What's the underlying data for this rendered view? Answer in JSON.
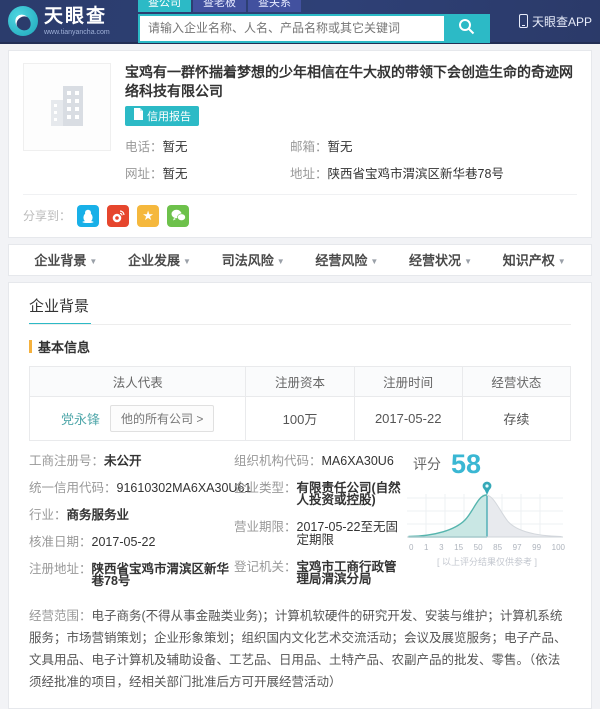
{
  "header": {
    "logo_title": "天眼查",
    "logo_subtitle": "www.tianyancha.com",
    "tabs": [
      {
        "label": "查公司"
      },
      {
        "label": "查老板"
      },
      {
        "label": "查关系"
      }
    ],
    "search_placeholder": "请输入企业名称、人名、产品名称或其它关键词",
    "app_link": "天眼查APP"
  },
  "company": {
    "name": "宝鸡有一群怀揣着梦想的少年相信在牛大叔的带领下会创造生命的奇迹网络科技有限公司",
    "credit_report_label": "信用报告",
    "phone_label": "电话：",
    "phone_value": "暂无",
    "email_label": "邮箱：",
    "email_value": "暂无",
    "website_label": "网址：",
    "website_value": "暂无",
    "address_label": "地址：",
    "address_value": "陕西省宝鸡市渭滨区新华巷78号",
    "share_label": "分享到：",
    "share_icons": [
      "qq",
      "weibo",
      "qzone",
      "wechat"
    ],
    "qzone_star": "★"
  },
  "nav": {
    "items": [
      {
        "label": "企业背景"
      },
      {
        "label": "企业发展"
      },
      {
        "label": "司法风险"
      },
      {
        "label": "经营风险"
      },
      {
        "label": "经营状况"
      },
      {
        "label": "知识产权"
      }
    ],
    "caret": "▼"
  },
  "section": {
    "title": "企业背景",
    "subsection_title": "基本信息",
    "table": {
      "headers": [
        "法人代表",
        "注册资本",
        "注册时间",
        "经营状态"
      ],
      "row": {
        "legal_rep": "党永锋",
        "companies_button": "他的所有公司 >",
        "capital": "100万",
        "reg_date": "2017-05-22",
        "status": "存续"
      }
    },
    "info_left": [
      {
        "label": "工商注册号：",
        "value": "未公开"
      },
      {
        "label": "统一信用代码：",
        "value": "91610302MA6XA30U61"
      },
      {
        "label": "行业：",
        "value": "商务服务业"
      },
      {
        "label": "核准日期：",
        "value": "2017-05-22"
      },
      {
        "label": "注册地址：",
        "value": "陕西省宝鸡市渭滨区新华巷78号"
      }
    ],
    "info_right": [
      {
        "label": "组织机构代码：",
        "value": "MA6XA30U6"
      },
      {
        "label": "企业类型：",
        "value": "有限责任公司(自然人投资或控股)"
      },
      {
        "label": "营业期限：",
        "value": "2017-05-22至无固定期限"
      },
      {
        "label": "登记机关：",
        "value": "宝鸡市工商行政管理局渭滨分局"
      }
    ],
    "score": {
      "label": "评分",
      "value": "58",
      "axis_labels": [
        "0",
        "1",
        "3",
        "15",
        "50",
        "85",
        "97",
        "99",
        "100"
      ],
      "caption": "[ 以上评分结果仅供参考 ]",
      "accent_color": "#3ab7d3",
      "curve_color": "#56b5ae"
    },
    "scope_label": "经营范围：",
    "scope_text": "电子商务(不得从事金融类业务)；计算机软硬件的研究开发、安装与维护；计算机系统服务；市场营销策划；企业形象策划；组织国内文化艺术交流活动；会议及展览服务；电子产品、文具用品、电子计算机及辅助设备、工艺品、日用品、土特产品、农副产品的批发、零售。（依法须经批准的项目，经相关部门批准后方可开展经营活动）"
  }
}
